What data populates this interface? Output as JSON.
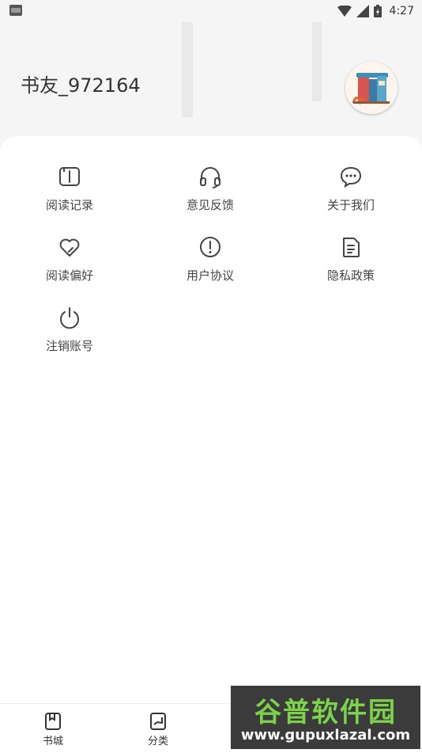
{
  "status_bar": {
    "time": "4:27"
  },
  "profile": {
    "username": "书友_972164"
  },
  "menu": {
    "items": [
      {
        "label": "阅读记录",
        "icon": "book-icon"
      },
      {
        "label": "意见反馈",
        "icon": "headset-icon"
      },
      {
        "label": "关于我们",
        "icon": "chat-bubble-icon"
      },
      {
        "label": "阅读偏好",
        "icon": "heart-icon"
      },
      {
        "label": "用户协议",
        "icon": "alert-circle-icon"
      },
      {
        "label": "隐私政策",
        "icon": "document-icon"
      },
      {
        "label": "注销账号",
        "icon": "power-icon"
      }
    ]
  },
  "bottom_nav": {
    "items": [
      {
        "label": "书城",
        "icon": "bookstore-icon"
      },
      {
        "label": "分类",
        "icon": "category-icon"
      }
    ]
  },
  "watermark": {
    "title": "谷普软件园",
    "url": "www.gupuxlazal.com"
  }
}
